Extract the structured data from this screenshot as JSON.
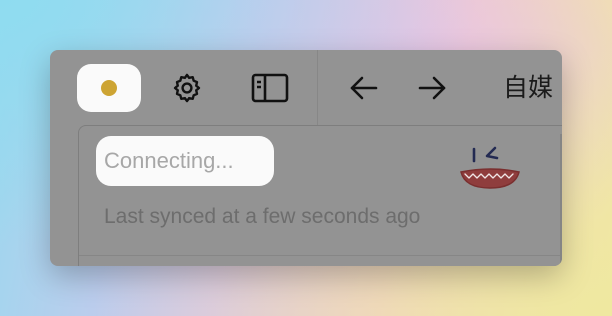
{
  "toolbar": {
    "status_icon": "status-dot-icon",
    "status_color": "#cda433",
    "settings_icon": "gear-icon",
    "sidebar_icon": "sidebar-toggle-icon",
    "back_icon": "arrow-left-icon",
    "forward_icon": "arrow-right-icon",
    "breadcrumb_text": "自媒"
  },
  "sync_panel": {
    "status_text": "Connecting...",
    "last_synced_text": "Last synced at a few seconds ago",
    "mascot_icon": "winking-face-icon"
  }
}
